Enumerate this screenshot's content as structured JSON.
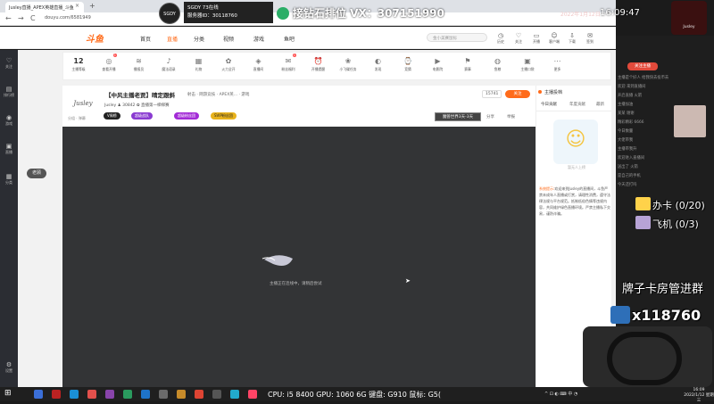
{
  "browser": {
    "tab_title": "Jusley直播_APEX英雄直播_斗鱼",
    "tab_close": "×",
    "new_tab": "+",
    "url": "douyu.com/6581949",
    "back": "←",
    "forward": "→",
    "reload": "C"
  },
  "site_header": {
    "logo": "斗鱼",
    "nav": [
      "首页",
      "直播",
      "分类",
      "视频",
      "游戏",
      "鱼吧"
    ],
    "search_placeholder": "金小美赛鼠标",
    "icons": [
      {
        "icon": "history-icon",
        "label": "历史"
      },
      {
        "icon": "follow-icon",
        "label": "关注"
      },
      {
        "icon": "handheld-icon",
        "label": "开播"
      },
      {
        "icon": "user-icon",
        "label": "客户端"
      },
      {
        "icon": "download-icon",
        "label": "下载"
      },
      {
        "icon": "gift-icon",
        "label": "签到"
      },
      {
        "icon": "home-icon",
        "label": "个人中心"
      }
    ]
  },
  "left_sidebar": {
    "items": [
      "关注",
      "排行榜",
      "游戏",
      "直播",
      "分类"
    ],
    "bottom": "设置",
    "bubble": "老顾"
  },
  "toolstrip": {
    "level": "12",
    "level_label": "主播等级",
    "items": [
      {
        "label": "查看开播",
        "badge": "1"
      },
      {
        "label": "播报员",
        "badge": ""
      },
      {
        "label": "魔法语录",
        "badge": ""
      },
      {
        "label": "礼物",
        "badge": ""
      },
      {
        "label": "火力全开",
        "badge": ""
      },
      {
        "label": "直播间",
        "badge": ""
      },
      {
        "label": "粉丝福利",
        "badge": "1"
      },
      {
        "label": "开播提醒",
        "badge": ""
      },
      {
        "label": "小飞碟任务",
        "badge": ""
      },
      {
        "label": "发现",
        "badge": ""
      },
      {
        "label": "竞猜",
        "badge": ""
      },
      {
        "label": "电影院",
        "badge": ""
      },
      {
        "label": "赛事",
        "badge": ""
      },
      {
        "label": "鱼粮",
        "badge": ""
      },
      {
        "label": "主播口袋",
        "badge": ""
      },
      {
        "label": "更多",
        "badge": ""
      }
    ]
  },
  "room": {
    "avatar_text": "Jusley",
    "title": "【中风主播老贾】晴定跟斜",
    "category": "射击 · 网游竞技 · APEX英... · 游戏",
    "id_line": "Jusley ♟ 30842 ✿ 直播第一梯梯赛",
    "report_badge": "举报",
    "tags": [
      "V周榜",
      "超级战队",
      "超级粉丝团",
      "SVIP粉丝团"
    ],
    "hot": "15741",
    "follow": "关注",
    "side_btn": "魔兽世界3天-3天",
    "share": "分享",
    "report": "举报",
    "small_btns": "分组 · 弹幕"
  },
  "video": {
    "loading_text": "主播正在连线中，请稍后尝试"
  },
  "right_panel": {
    "header": "主播投档",
    "tabs": [
      "今日贡献",
      "年度贡献",
      "最新"
    ],
    "mascot_caption": "暂无人上榜",
    "notice_prefix": "系统提示:",
    "notice_text": "欢迎来到Jusley的直播间，斗鱼严禁未成年人直播或打赏，请理性消费，遵守法律法规与平台规范。抵制低俗色情等违规内容，共同维护绿色直播环境。严禁主播私下交易，谨防诈骗。"
  },
  "overlay": {
    "sgdy_line1": "SGDY 73在线",
    "sgdy_line2": "服务器ID：30118760",
    "vx": "接钻石排位 VX：307151990",
    "date": "2022年1月12日",
    "time": "16:09:47",
    "avatar_name": "Jusley",
    "chat_lines": [
      "主播是个好人 给我快去投币去",
      "欢迎 来到直播间",
      "开启直播 火箭",
      "主播加油",
      "某某 谢谢",
      "精彩精彩 6666",
      "今日数量",
      "大佬带我",
      "主播带我升",
      "欢迎进入直播间",
      "送出了 火箭",
      "是自己的手机",
      "今天还打吗"
    ],
    "chat_button": "关注主播",
    "row1": "办卡 (0/20)",
    "row2": "飞机 (0/3)",
    "card_text": "牌子卡房管进群",
    "count": "x118760"
  },
  "taskbar": {
    "specs": "CPU: i5 8400  GPU: 1060 6G  键盘: G910  鼠标: G5(",
    "tray": "^ ⊡ ◐ ⌨ 中 ◔",
    "clock_time": "16:09",
    "clock_date": "2022/1/12 星期三"
  }
}
